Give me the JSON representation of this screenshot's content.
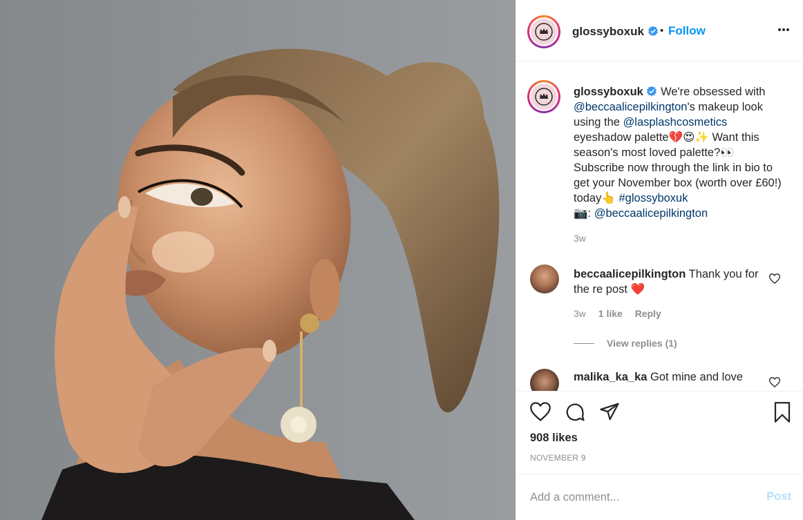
{
  "header": {
    "username": "glossyboxuk",
    "separator": "•",
    "follow_label": "Follow"
  },
  "caption": {
    "username": "glossyboxuk",
    "parts": {
      "p1": "We're obsessed with ",
      "m1": "@beccaalicepilkington",
      "p2": "'s makeup look using the ",
      "m2": "@lasplashcosmetics",
      "p3": " eyeshadow palette💔😍✨ Want this season's most loved palette?👀 Subscribe now through the link in bio to get your November box (worth over £60!) today👆 ",
      "m3": "#glossyboxuk",
      "p4": "📷: ",
      "m4": "@beccaalicepilkington"
    },
    "time": "3w"
  },
  "comments": [
    {
      "username": "beccaalicepilkington",
      "text": "Thank you for the re post ❤️",
      "time": "3w",
      "likes": "1 like",
      "reply_label": "Reply",
      "view_replies": "View replies (1)"
    },
    {
      "username": "malika_ka_ka",
      "text": "Got mine and love"
    }
  ],
  "actions": {
    "likes": "908 likes",
    "date": "NOVEMBER 9"
  },
  "add_comment": {
    "placeholder": "Add a comment...",
    "post_label": "Post"
  },
  "colors": {
    "accent": "#0095f6",
    "mention": "#00376b",
    "muted": "#8e8e8e",
    "post_disabled": "#b2dffc"
  }
}
